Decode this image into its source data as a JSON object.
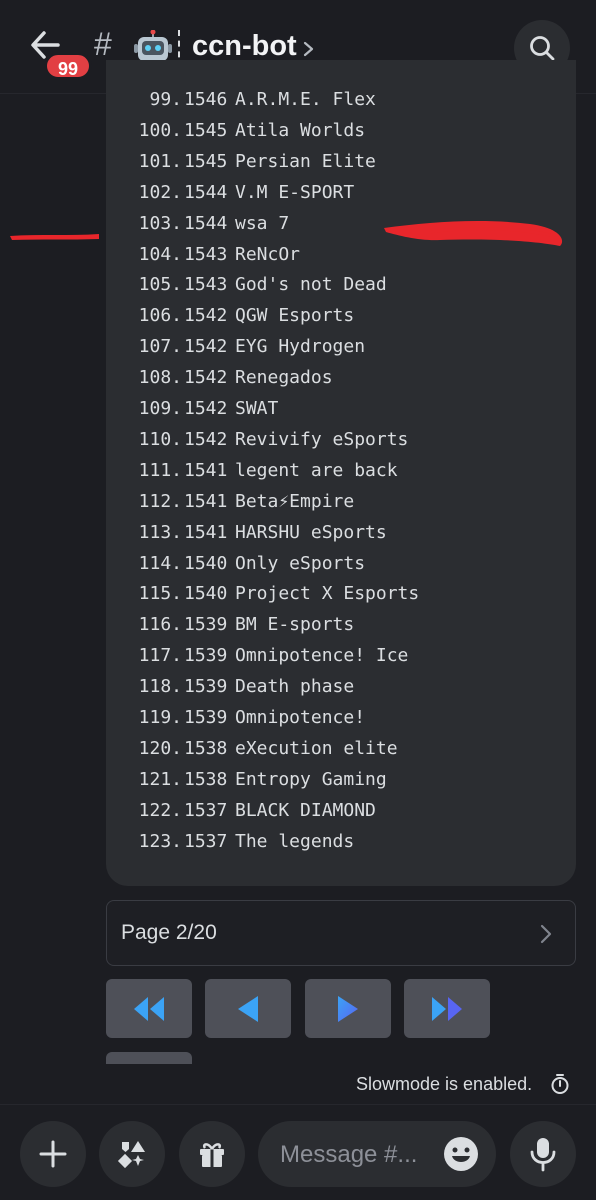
{
  "header": {
    "unread_badge": "99",
    "hash": "#",
    "channel_name": "ccn-bot"
  },
  "leaderboard": [
    {
      "rank": "99.",
      "score": "1546",
      "team": "A.R.M.E. Flex"
    },
    {
      "rank": "100.",
      "score": "1545",
      "team": "Atila Worlds"
    },
    {
      "rank": "101.",
      "score": "1545",
      "team": "Persian Elite"
    },
    {
      "rank": "102.",
      "score": "1544",
      "team": "V.M E-SPORT"
    },
    {
      "rank": "103.",
      "score": "1544",
      "team": "wsa 7"
    },
    {
      "rank": "104.",
      "score": "1543",
      "team": "ReNcOr"
    },
    {
      "rank": "105.",
      "score": "1543",
      "team": "God's not Dead"
    },
    {
      "rank": "106.",
      "score": "1542",
      "team": "QGW Esports"
    },
    {
      "rank": "107.",
      "score": "1542",
      "team": "EYG Hydrogen"
    },
    {
      "rank": "108.",
      "score": "1542",
      "team": "Renegados"
    },
    {
      "rank": "109.",
      "score": "1542",
      "team": "SWAT"
    },
    {
      "rank": "110.",
      "score": "1542",
      "team": "Revivify eSports"
    },
    {
      "rank": "111.",
      "score": "1541",
      "team": "legent are back"
    },
    {
      "rank": "112.",
      "score": "1541",
      "team": "Beta⚡Empire"
    },
    {
      "rank": "113.",
      "score": "1541",
      "team": "HARSHU eSports"
    },
    {
      "rank": "114.",
      "score": "1540",
      "team": "Only eSports"
    },
    {
      "rank": "115.",
      "score": "1540",
      "team": "Project X Esports"
    },
    {
      "rank": "116.",
      "score": "1539",
      "team": "BM E-sports"
    },
    {
      "rank": "117.",
      "score": "1539",
      "team": "Omnipotence! Ice"
    },
    {
      "rank": "118.",
      "score": "1539",
      "team": "Death phase"
    },
    {
      "rank": "119.",
      "score": "1539",
      "team": "Omnipotence!"
    },
    {
      "rank": "120.",
      "score": "1538",
      "team": "eXecution elite"
    },
    {
      "rank": "121.",
      "score": "1538",
      "team": "Entropy Gaming"
    },
    {
      "rank": "122.",
      "score": "1537",
      "team": "BLACK DIAMOND"
    },
    {
      "rank": "123.",
      "score": "1537",
      "team": "The legends"
    }
  ],
  "pagination": {
    "page_label": "Page 2/20",
    "buttons": [
      "first-page",
      "previous-page",
      "next-page",
      "last-page"
    ]
  },
  "footer": {
    "slowmode_text": "Slowmode is enabled.",
    "message_placeholder": "Message #..."
  },
  "colors": {
    "background": "#1c1d22",
    "card": "#2b2d31",
    "badge": "#e23f43",
    "nav_button": "#4e5058",
    "arrow_blue": "#5865f2",
    "annotation_red": "#e8262b"
  }
}
